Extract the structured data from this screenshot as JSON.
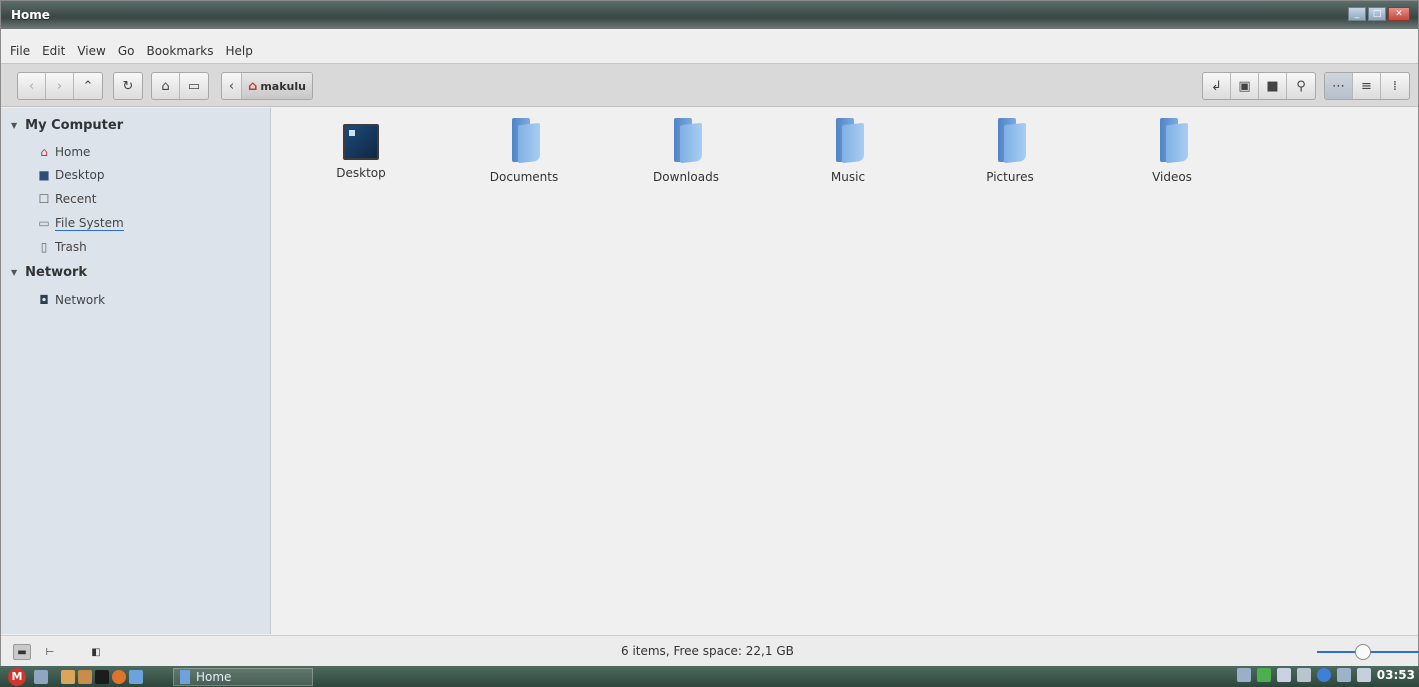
{
  "window": {
    "title": "Home"
  },
  "menubar": {
    "items": [
      "File",
      "Edit",
      "View",
      "Go",
      "Bookmarks",
      "Help"
    ]
  },
  "toolbar": {
    "back_icon": "chevron-left-icon",
    "forward_icon": "chevron-right-icon",
    "up_icon": "chevron-up-icon",
    "reload_icon": "reload-icon",
    "home_icon": "home-icon",
    "computer_icon": "computer-icon",
    "breadcrumb_prev_icon": "chevron-left-icon",
    "breadcrumb_label": "makulu",
    "right_icons": [
      "open-terminal-icon",
      "terminal-icon",
      "new-folder-icon",
      "search-icon"
    ],
    "view_icons": [
      "icon-view-icon",
      "list-view-icon",
      "compact-view-icon"
    ]
  },
  "sidebar": {
    "sections": [
      {
        "label": "My Computer",
        "items": [
          {
            "label": "Home",
            "icon": "home-icon"
          },
          {
            "label": "Desktop",
            "icon": "desktop-icon"
          },
          {
            "label": "Recent",
            "icon": "recent-icon"
          },
          {
            "label": "File System",
            "icon": "drive-icon"
          },
          {
            "label": "Trash",
            "icon": "trash-icon"
          }
        ]
      },
      {
        "label": "Network",
        "items": [
          {
            "label": "Network",
            "icon": "network-icon"
          }
        ]
      }
    ]
  },
  "content": {
    "files": [
      {
        "label": "Desktop",
        "icon": "desktop-folder-icon"
      },
      {
        "label": "Documents",
        "icon": "folder-icon"
      },
      {
        "label": "Downloads",
        "icon": "folder-icon"
      },
      {
        "label": "Music",
        "icon": "folder-icon"
      },
      {
        "label": "Pictures",
        "icon": "folder-icon"
      },
      {
        "label": "Videos",
        "icon": "folder-icon"
      }
    ]
  },
  "statusbar": {
    "text": "6 items, Free space: 22,1 GB",
    "zoom_level": 0.35
  },
  "taskbar": {
    "task_label": "Home",
    "clock": "03:53"
  },
  "colors": {
    "sidebar_bg": "#dde3eb",
    "accent": "#2a6fd6",
    "folder": "#7fb0e4"
  }
}
